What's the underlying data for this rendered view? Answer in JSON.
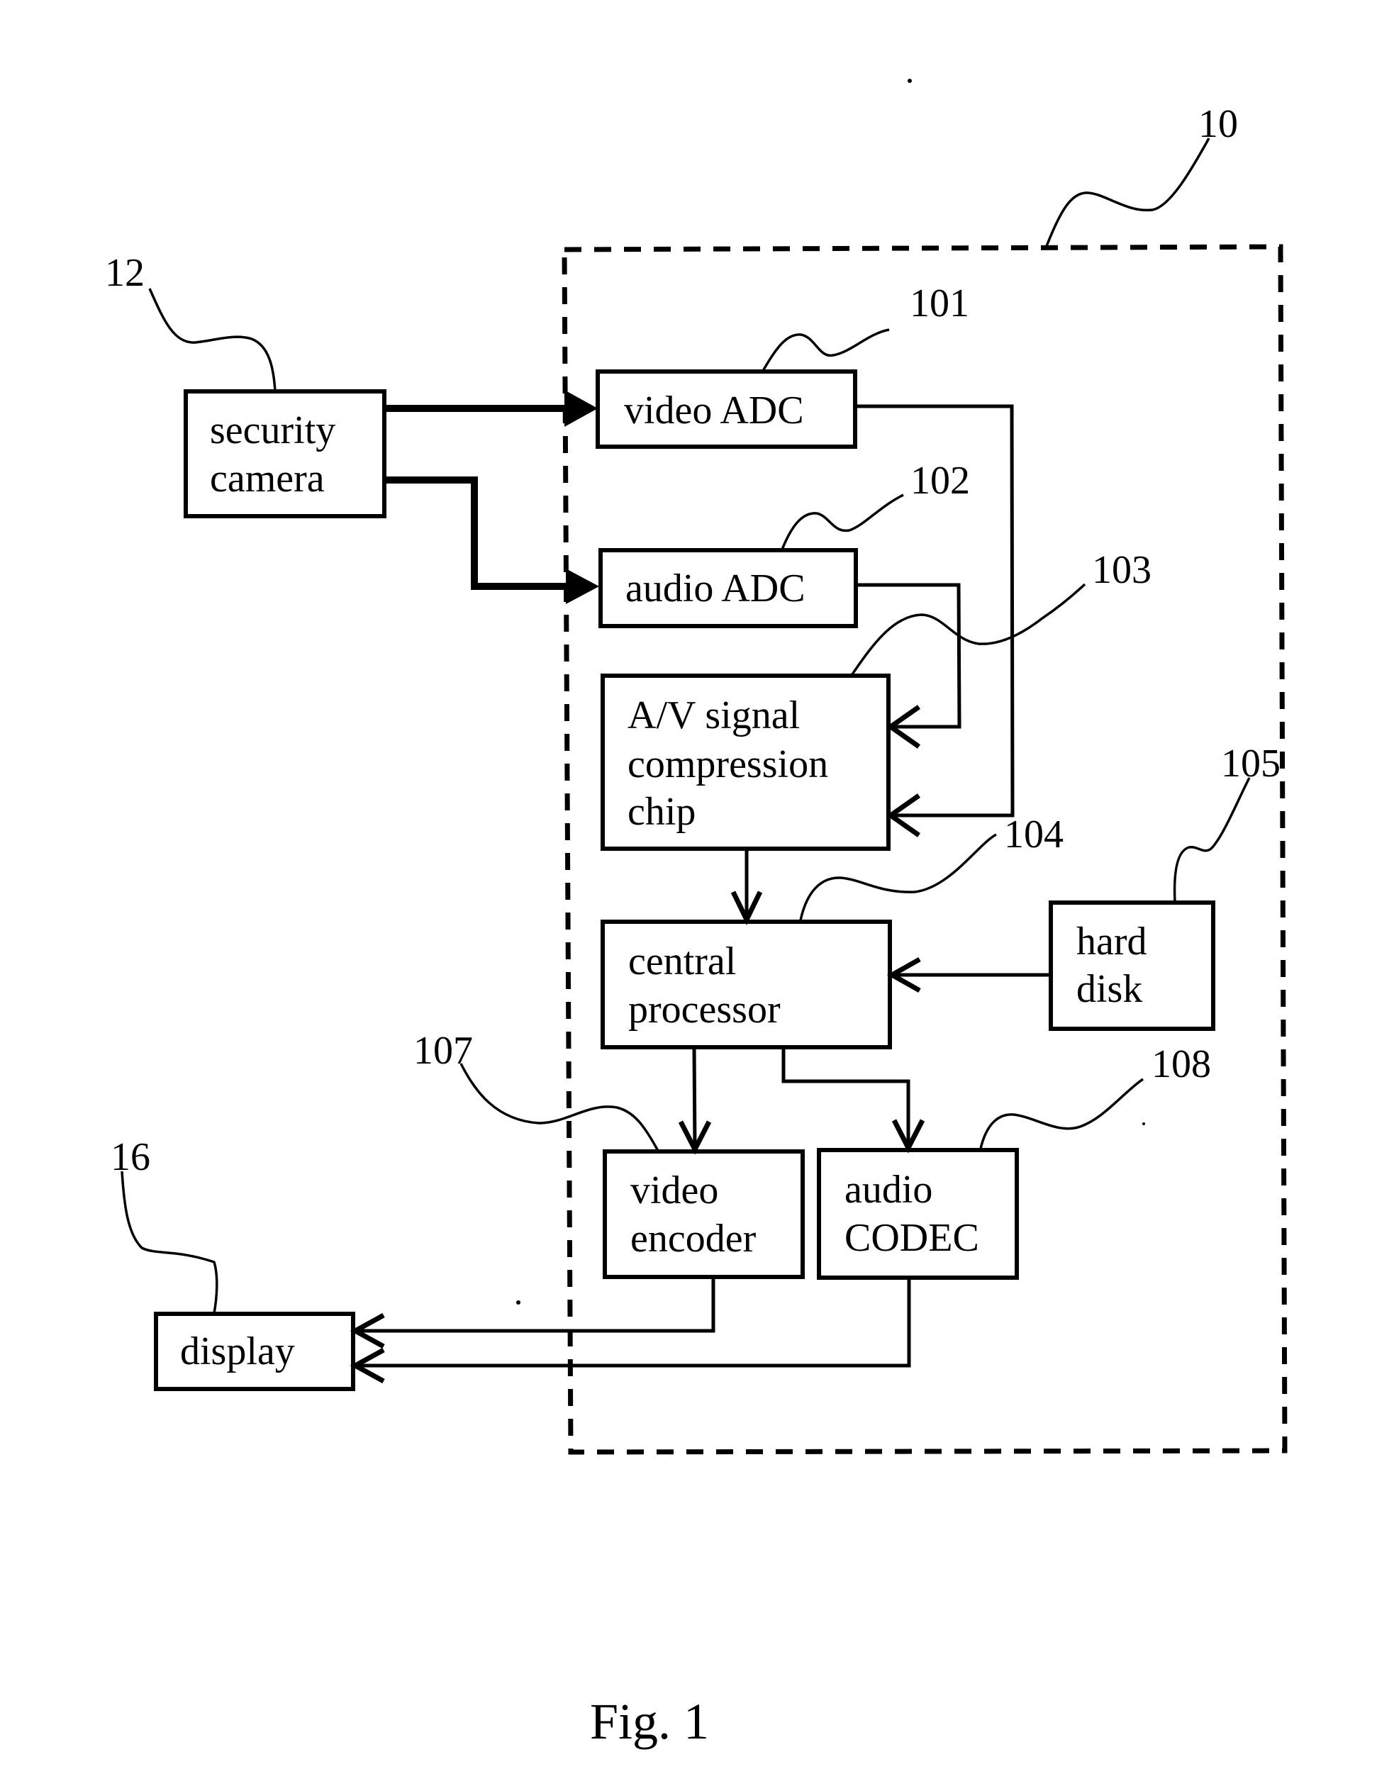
{
  "figure": {
    "caption": "Fig. 1",
    "system_ref": "10"
  },
  "blocks": {
    "security_camera": {
      "ref": "12",
      "lines": [
        "security",
        "camera"
      ]
    },
    "video_adc": {
      "ref": "101",
      "lines": [
        "video ADC"
      ]
    },
    "audio_adc": {
      "ref": "102",
      "lines": [
        "audio ADC"
      ]
    },
    "av_compression_chip": {
      "ref": "103",
      "lines": [
        "A/V signal",
        "compression",
        "chip"
      ]
    },
    "central_processor": {
      "ref": "104",
      "lines": [
        "central",
        "processor"
      ]
    },
    "hard_disk": {
      "ref": "105",
      "lines": [
        "hard",
        "disk"
      ]
    },
    "video_encoder": {
      "ref": "107",
      "lines": [
        "video",
        "encoder"
      ]
    },
    "audio_codec": {
      "ref": "108",
      "lines": [
        "audio",
        "CODEC"
      ]
    },
    "display": {
      "ref": "16",
      "lines": [
        "display"
      ]
    }
  },
  "connections": [
    {
      "from": "security camera",
      "to": "video ADC",
      "style": "thick solid arrow"
    },
    {
      "from": "security camera",
      "to": "audio ADC",
      "style": "thick solid arrow"
    },
    {
      "from": "video ADC",
      "to": "A/V signal compression chip",
      "style": "open arrow"
    },
    {
      "from": "audio ADC",
      "to": "A/V signal compression chip",
      "style": "open arrow"
    },
    {
      "from": "A/V signal compression chip",
      "to": "central processor",
      "style": "open arrow"
    },
    {
      "from": "hard disk",
      "to": "central processor",
      "style": "open arrow"
    },
    {
      "from": "central processor",
      "to": "video encoder",
      "style": "open arrow"
    },
    {
      "from": "central processor",
      "to": "audio CODEC",
      "style": "open arrow"
    },
    {
      "from": "video encoder",
      "to": "display",
      "style": "open arrow"
    },
    {
      "from": "audio CODEC",
      "to": "display",
      "style": "open arrow"
    }
  ]
}
